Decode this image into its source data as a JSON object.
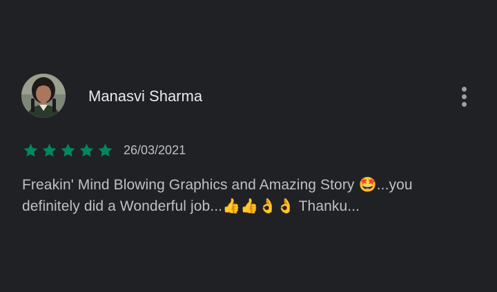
{
  "review": {
    "reviewer_name": "Manasvi Sharma",
    "rating": 5,
    "rating_max": 5,
    "date": "26/03/2021",
    "text": "Freakin' Mind Blowing Graphics and Amazing Story 🤩...you definitely did a Wonderful job...👍👍👌👌 Thanku..."
  },
  "icons": {
    "avatar": "profile-photo",
    "more": "more-vert-icon",
    "star": "star-icon"
  },
  "colors": {
    "background": "#202124",
    "star_filled": "#01875f",
    "name_text": "#e8eaed",
    "body_text": "#bdc1c6"
  }
}
